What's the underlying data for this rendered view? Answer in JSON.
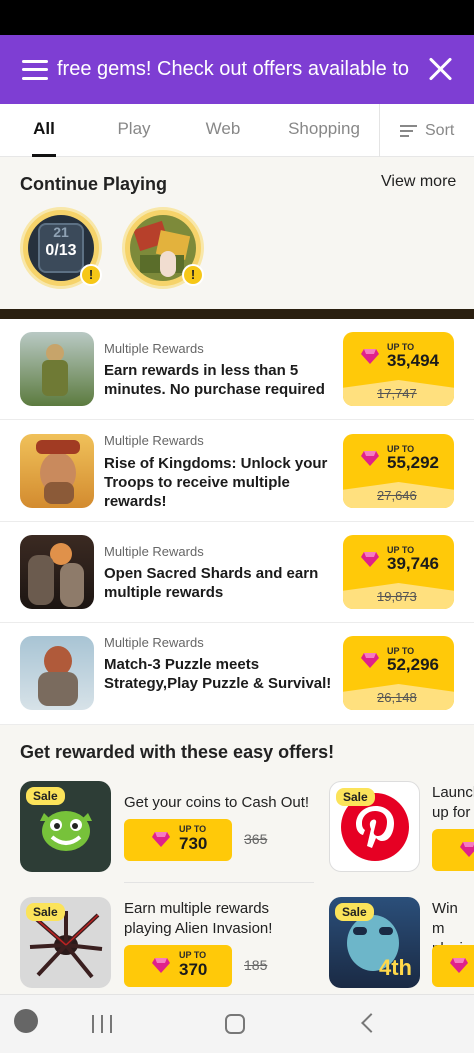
{
  "banner": {
    "text": "free gems! Check out offers available to"
  },
  "tabs": [
    "All",
    "Play",
    "Web",
    "Shopping"
  ],
  "sort_label": "Sort",
  "continue_playing": {
    "title": "Continue Playing",
    "view_more": "View more",
    "items": [
      {
        "progress_top": "21",
        "progress": "0/13"
      },
      {}
    ]
  },
  "offers": [
    {
      "tag": "Multiple Rewards",
      "title": "Earn rewards in less than 5 minutes. No purchase required",
      "upto": "UP TO",
      "amount": "35,494",
      "old": "17,747"
    },
    {
      "tag": "Multiple Rewards",
      "title": "Rise of Kingdoms: Unlock your Troops to receive multiple rewards!",
      "upto": "UP TO",
      "amount": "55,292",
      "old": "27,646"
    },
    {
      "tag": "Multiple Rewards",
      "title": "Open Sacred Shards and earn multiple rewards",
      "upto": "UP TO",
      "amount": "39,746",
      "old": "19,873"
    },
    {
      "tag": "Multiple Rewards",
      "title": "Match-3 Puzzle meets Strategy,Play Puzzle & Survival!",
      "upto": "UP TO",
      "amount": "52,296",
      "old": "26,148"
    }
  ],
  "easy_offers": {
    "title": "Get rewarded with these easy offers!",
    "items": [
      {
        "sale": "Sale",
        "title": "Get your coins to Cash Out!",
        "upto": "UP TO",
        "amount": "730",
        "old": "365"
      },
      {
        "sale": "Sale",
        "title": "Launch up for",
        "upto": "",
        "amount": "",
        "old": ""
      },
      {
        "sale": "Sale",
        "title": "Earn multiple rewards playing Alien Invasion!",
        "upto": "UP TO",
        "amount": "370",
        "old": "185"
      },
      {
        "sale": "Sale",
        "title": "Win m playin",
        "upto": "",
        "amount": "",
        "old": ""
      }
    ],
    "thumb4_label": "4th"
  },
  "colors": {
    "banner": "#7e3ed3",
    "reward": "#ffc909",
    "gem": "#e0218a"
  }
}
